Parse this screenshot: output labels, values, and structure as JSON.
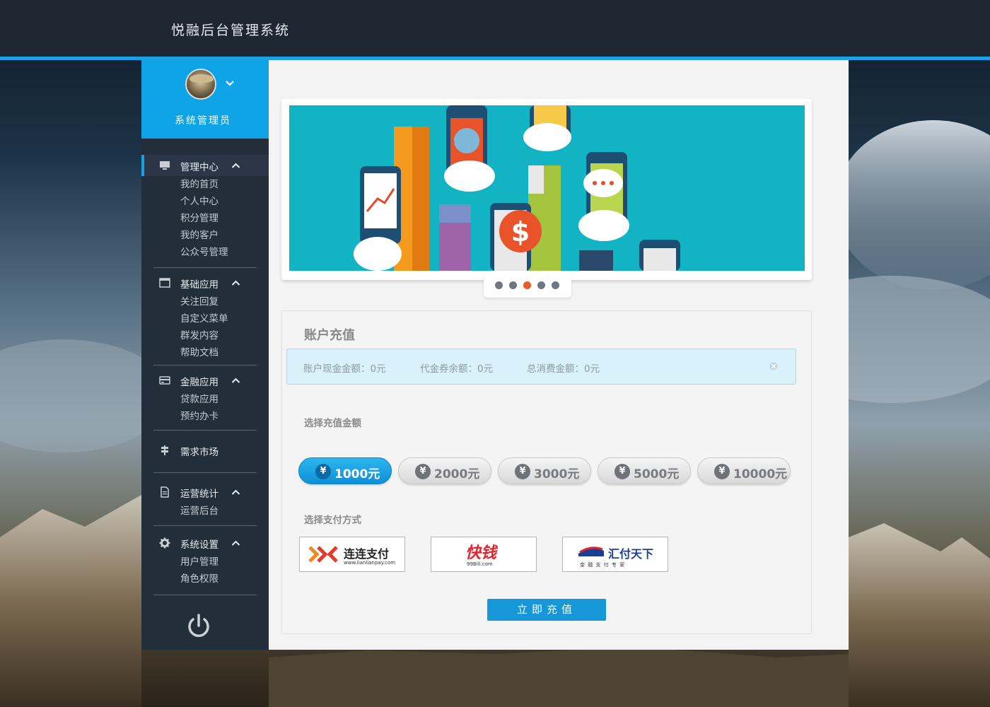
{
  "app": {
    "title": "悦融后台管理系统"
  },
  "user": {
    "name": "系统管理员"
  },
  "menu": [
    {
      "label": "管理中心",
      "icon": "monitor-icon",
      "items": [
        "我的首页",
        "个人中心",
        "积分管理",
        "我的客户",
        "公众号管理"
      ]
    },
    {
      "label": "基础应用",
      "icon": "window-icon",
      "items": [
        "关注回复",
        "自定义菜单",
        "群发内容",
        "帮助文档"
      ]
    },
    {
      "label": "金融应用",
      "icon": "card-icon",
      "items": [
        "贷款应用",
        "预约办卡"
      ]
    },
    {
      "label": "需求市场",
      "icon": "signpost-icon",
      "items": []
    },
    {
      "label": "运营统计",
      "icon": "document-icon",
      "items": [
        "运营后台"
      ]
    },
    {
      "label": "系统设置",
      "icon": "gear-icon",
      "items": [
        "用户管理",
        "角色权限"
      ]
    }
  ],
  "carousel": {
    "slides": 5,
    "active_index": 2
  },
  "recharge": {
    "title": "账户充值",
    "info": {
      "cash_balance": "账户现金金额：0元",
      "voucher_balance": "代金券余额：0元",
      "total_spent": "总消费金额：0元"
    },
    "amount_label": "选择充值金额",
    "currency_symbol": "¥",
    "amounts": [
      "1000元",
      "2000元",
      "3000元",
      "5000元",
      "10000元"
    ],
    "selected_amount_index": 0,
    "payment_label": "选择支付方式",
    "payments": [
      {
        "name": "连连支付",
        "sub": "www.lianlianpay.com"
      },
      {
        "name": "快钱",
        "sub": "99Bill.com"
      },
      {
        "name": "汇付天下",
        "sub": "金 融 支 付 专 家"
      }
    ],
    "submit_label": "立即充值"
  },
  "colors": {
    "accent": "#1aa1e6",
    "header_bg": "#1f2732",
    "sidebar_bg": "#232e3b",
    "active_dot": "#ec5c2a"
  }
}
